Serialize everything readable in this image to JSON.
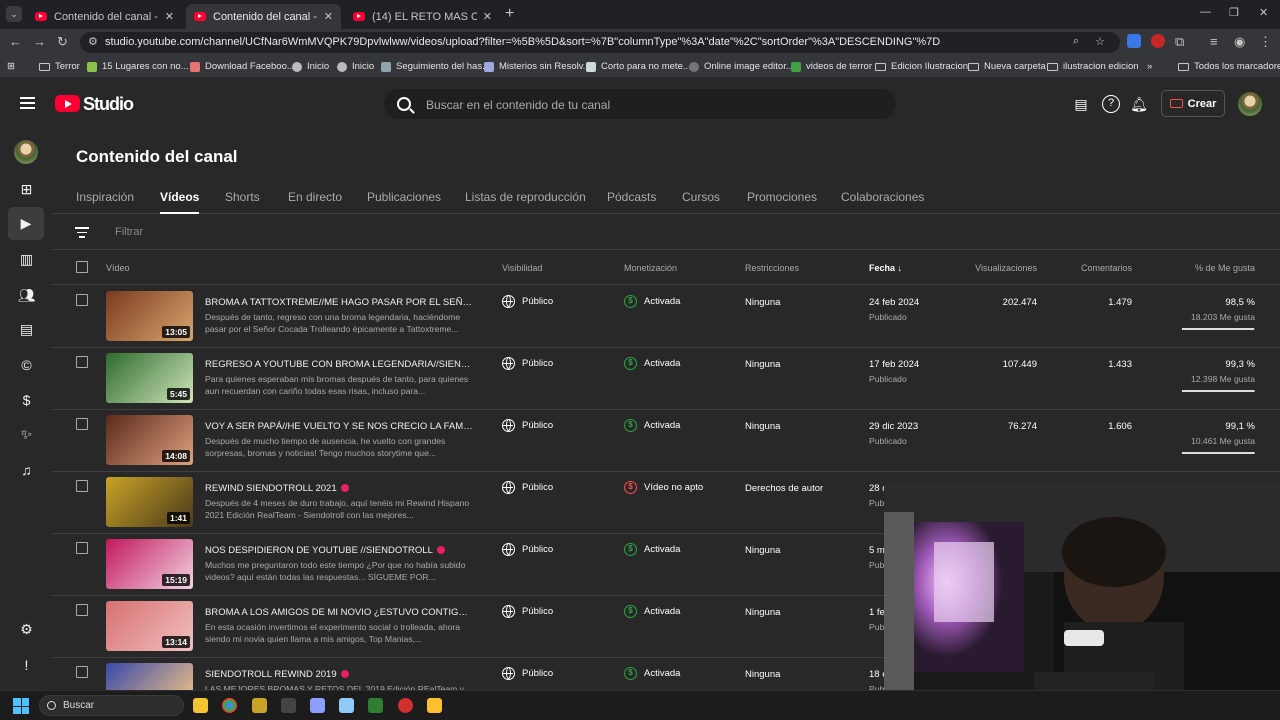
{
  "browser": {
    "tabs": [
      {
        "title": "Contenido del canal - YouTube"
      },
      {
        "title": "Contenido del canal - YouTube"
      },
      {
        "title": "(14) EL RETO MAS ORIGINAL DE"
      }
    ],
    "url": "studio.youtube.com/channel/UCfNar6WmMVQPK79Dpvlwlww/videos/upload?filter=%5B%5D&sort=%7B\"columnType\"%3A\"date\"%2C\"sortOrder\"%3A\"DESCENDING\"%7D",
    "bookmarks": [
      "Terror",
      "15 Lugares con no...",
      "Download Faceboo...",
      "Inicio",
      "Inicio",
      "Seguimiento del has...",
      "Misterios sin Resolv...",
      "Corto para no mete...",
      "Online image editor...",
      "videos de terror",
      "Edicion Ilustracion",
      "Nueva carpeta",
      "ilustracion edicion"
    ],
    "all_bookmarks": "Todos los marcadores"
  },
  "studio": {
    "logo": "Studio",
    "search_placeholder": "Buscar en el contenido de tu canal",
    "create_label": "Crear",
    "page_title": "Contenido del canal",
    "tabs": [
      "Inspiración",
      "Vídeos",
      "Shorts",
      "En directo",
      "Publicaciones",
      "Listas de reproducción",
      "Pódcasts",
      "Cursos",
      "Promociones",
      "Colaboraciones"
    ],
    "filter_placeholder": "Filtrar",
    "columns": {
      "video": "Vídeo",
      "visibility": "Visibilidad",
      "monetization": "Monetización",
      "restrictions": "Restricciones",
      "date": "Fecha",
      "views": "Visualizaciones",
      "comments": "Comentarios",
      "likes": "% de Me gusta"
    }
  },
  "videos": [
    {
      "title": "BROMA A TATTOXTREME//ME HAGO PASAR POR EL SEÑOR ...",
      "desc": "Después de tanto, regreso con una broma legendaria, haciéndome pasar por el Señor Cocada Trolleando épicamente a Tattoxtreme...",
      "duration": "13:05",
      "visibility": "Público",
      "monetization": "Activada",
      "restriction": "Ninguna",
      "date": "24 feb 2024",
      "date_status": "Publicado",
      "views": "202.474",
      "comments": "1.479",
      "like_pct": "98,5 %",
      "like_count": "18.203 Me gusta",
      "like_frac": 0.985,
      "dot": false,
      "blocked": false
    },
    {
      "title": "REGRESO A YOUTUBE CON BROMA LEGENDARIA//SIENDOTR...",
      "desc": "Para quienes esperaban mis bromas después de tanto, para quienes aun recuerdan con cariño todas esas risas, incluso para...",
      "duration": "5:45",
      "visibility": "Público",
      "monetization": "Activada",
      "restriction": "Ninguna",
      "date": "17 feb 2024",
      "date_status": "Publicado",
      "views": "107.449",
      "comments": "1.433",
      "like_pct": "99,3 %",
      "like_count": "12.398 Me gusta",
      "like_frac": 0.993,
      "dot": false,
      "blocked": false
    },
    {
      "title": "VOY A SER PAPÁ//HE VUELTO Y SE NOS CRECIO LA FAMILIA/...",
      "desc": "Después de mucho tiempo de ausencia, he vuelto con grandes sorpresas, bromas y noticias! Tengo muchos storytime que...",
      "duration": "14:08",
      "visibility": "Público",
      "monetization": "Activada",
      "restriction": "Ninguna",
      "date": "29 dic 2023",
      "date_status": "Publicado",
      "views": "76.274",
      "comments": "1.606",
      "like_pct": "99,1 %",
      "like_count": "10.461 Me gusta",
      "like_frac": 0.991,
      "dot": false,
      "blocked": false
    },
    {
      "title": "REWIND SIENDOTROLL 2021",
      "desc": "Después de 4 meses de duro trabajo, aquí tenéis mi Rewind Hispano 2021 Edición RealTeam - Siendotroll con las mejores...",
      "duration": "1:41",
      "visibility": "Público",
      "monetization": "Vídeo no apto",
      "restriction": "Derechos de autor",
      "date": "28 d",
      "date_status": "Pub",
      "views": "",
      "comments": "",
      "like_pct": "",
      "like_count": "",
      "like_frac": 0,
      "dot": true,
      "blocked": true
    },
    {
      "title": "NOS DESPIDIERON DE YOUTUBE //SIENDOTROLL",
      "desc": "Muchos me preguntaron todo este tiempo ¿Por que no había subido videos? aquí están todas las respuestas... SÍGUEME POR...",
      "duration": "15:19",
      "visibility": "Público",
      "monetization": "Activada",
      "restriction": "Ninguna",
      "date": "5 m",
      "date_status": "Pub",
      "views": "",
      "comments": "",
      "like_pct": "",
      "like_count": "",
      "like_frac": 0,
      "dot": true,
      "blocked": false
    },
    {
      "title": "BROMA A LOS AMIGOS DE MI NOVIO ¿ESTUVO CONTIGO?//P...",
      "desc": "En esta ocasión invertimos el experimento social o trolleada, ahora siendo mi novia quien llama a mis amigos, Top Manias,...",
      "duration": "13:14",
      "visibility": "Público",
      "monetization": "Activada",
      "restriction": "Ninguna",
      "date": "1 fe",
      "date_status": "Pub",
      "views": "",
      "comments": "",
      "like_pct": "",
      "like_count": "",
      "like_frac": 0,
      "dot": false,
      "blocked": false
    },
    {
      "title": "SIENDOTROLL REWIND 2019",
      "desc": "LAS MEJORES BROMAS Y RETOS DEL 2019 Edición REalTeam y...",
      "duration": "",
      "visibility": "Público",
      "monetization": "Activada",
      "restriction": "Ninguna",
      "date": "18 e",
      "date_status": "Pub",
      "views": "",
      "comments": "",
      "like_pct": "",
      "like_count": "",
      "like_frac": 0,
      "dot": true,
      "blocked": false
    }
  ],
  "taskbar": {
    "search_placeholder": "Buscar"
  }
}
